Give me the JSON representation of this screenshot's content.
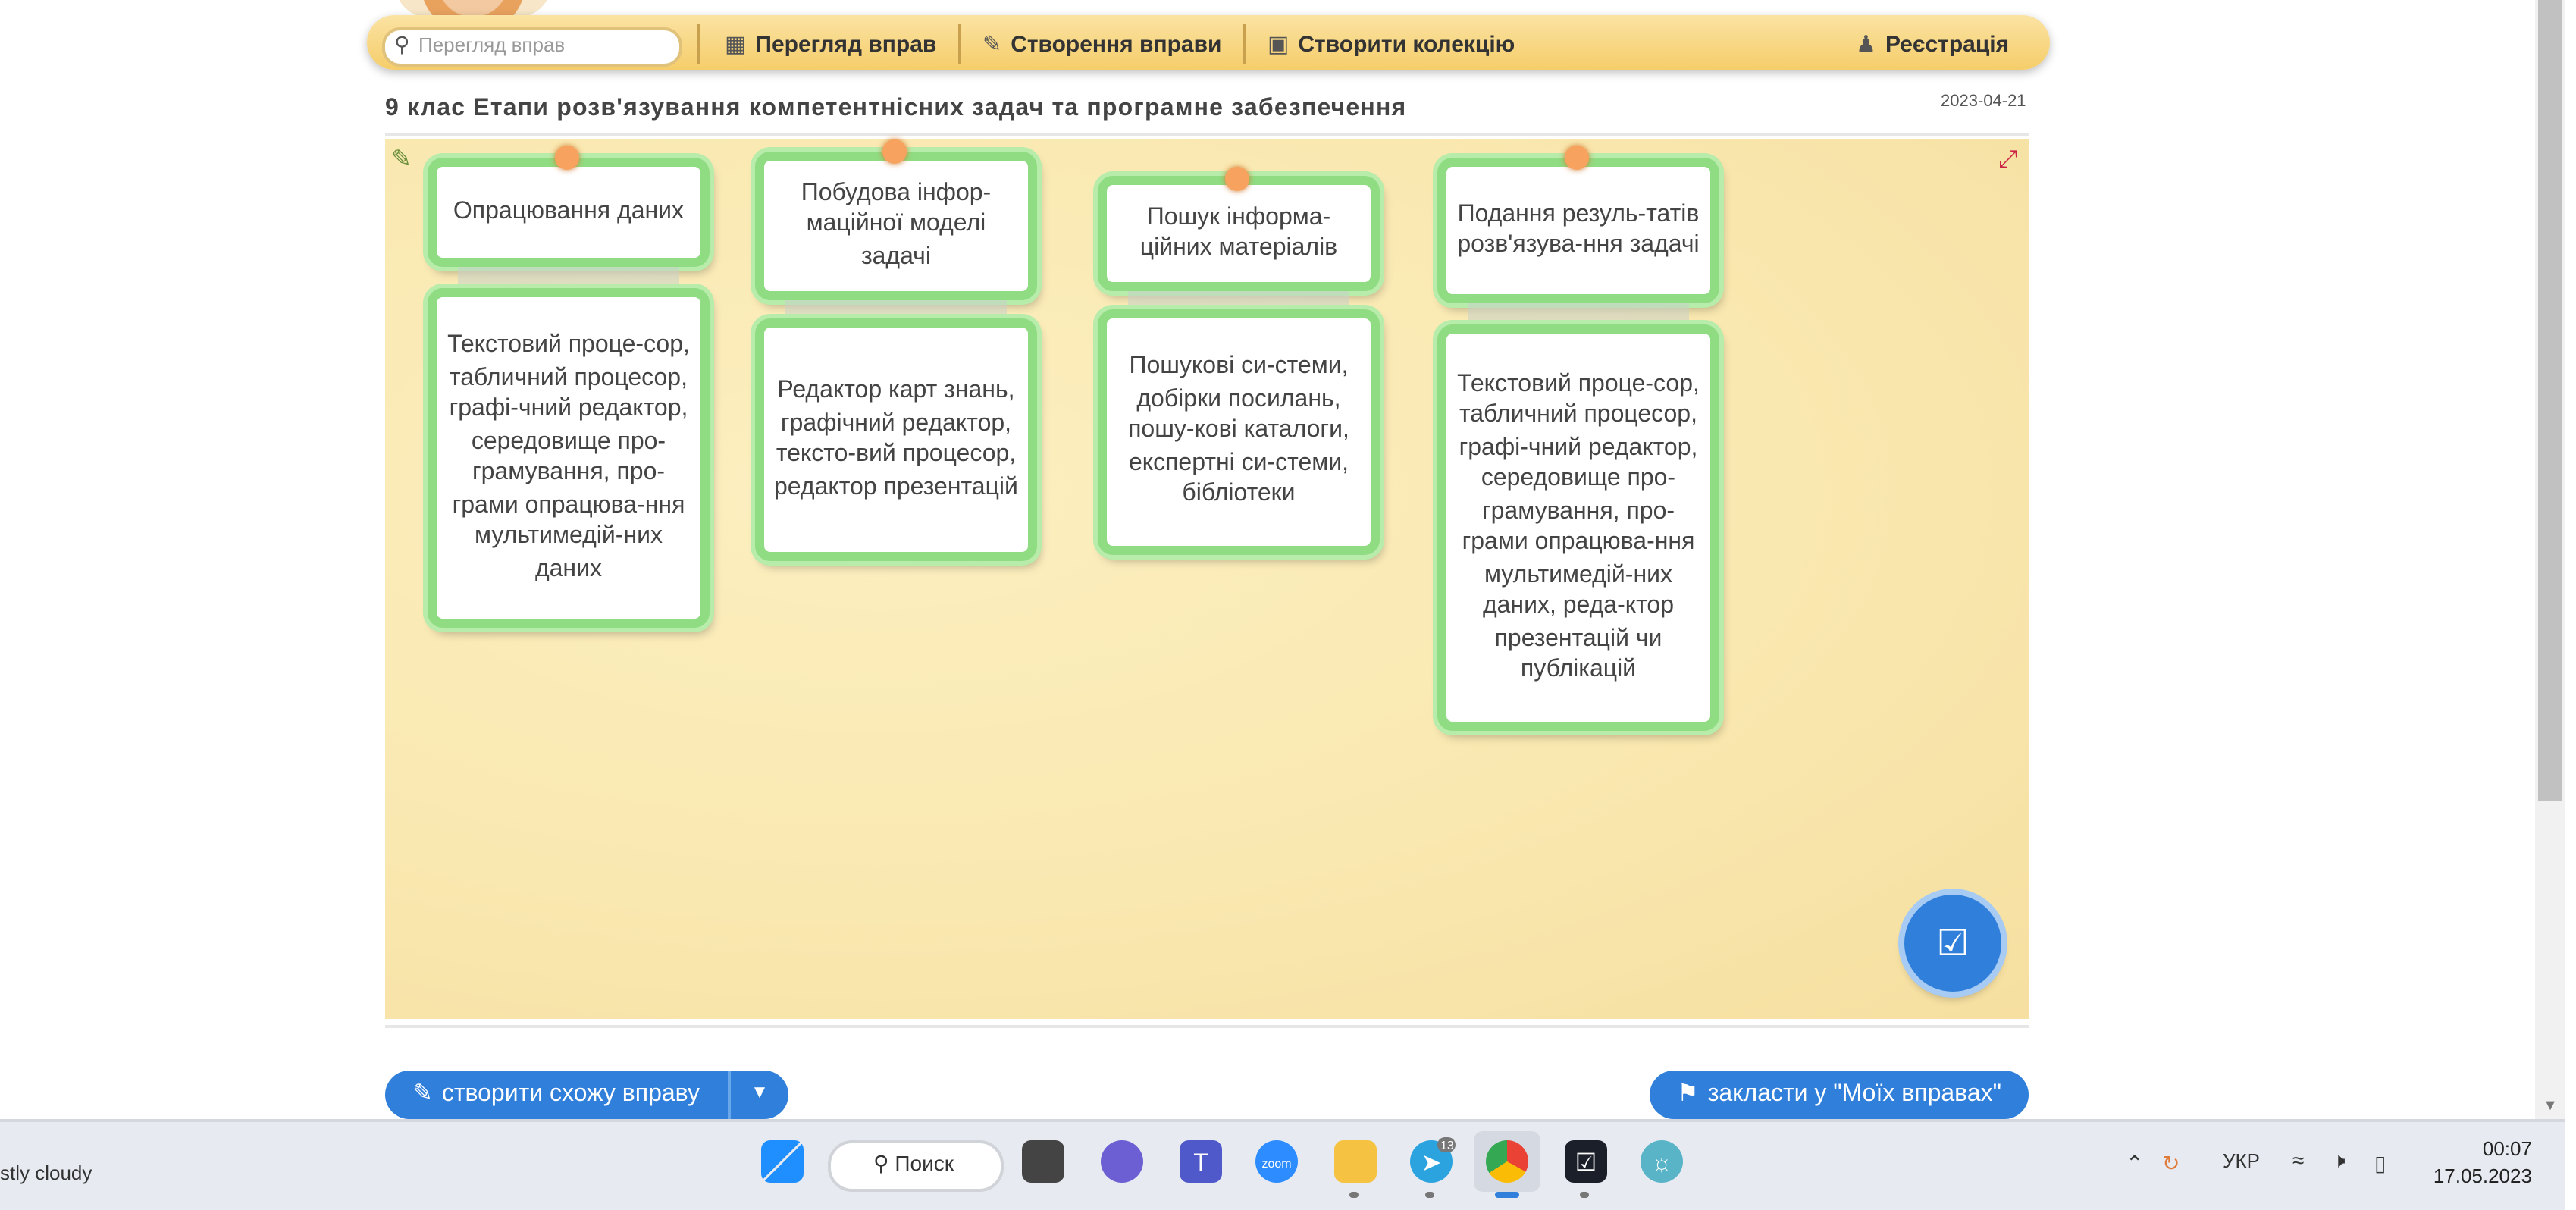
{
  "nav": {
    "search_placeholder": "Перегляд вправ",
    "browse_label": "Перегляд вправ",
    "create_label": "Створення вправи",
    "collection_label": "Створити колекцію",
    "register_label": "Реєстрація"
  },
  "exercise": {
    "title": "9 клас Етапи розв'язування компетентнісних задач та програмне забезпечення",
    "date": "2023-04-21",
    "columns": [
      {
        "header": "Опрацювання даних",
        "body": "Текстовий проце-сор, табличний процесор, графі-чний редактор, середовище про-грамування, про-грами опрацюва-ння мультимедій-них даних"
      },
      {
        "header": "Побудова інфор-маційної моделі задачі",
        "body": "Редактор карт знань, графічний редактор, тексто-вий процесор, редактор презентацій"
      },
      {
        "header": "Пошук інформа-ційних матеріалів",
        "body": "Пошукові си-стеми, добірки посилань, пошу-кові каталоги, експертні си-стеми, бібліотеки"
      },
      {
        "header": "Подання резуль-татів розв'язува-ння задачі",
        "body": "Текстовий проце-сор, табличний процесор, графі-чний редактор, середовище про-грамування, про-грами опрацюва-ння мультимедій-них даних, реда-ктор презентацій чи публікацій"
      }
    ]
  },
  "actions": {
    "create_similar": "створити схожу вправу",
    "bookmark": "закласти у \"Моїх вправах\""
  },
  "taskbar": {
    "weather": "stly cloudy",
    "search_label": "Поиск",
    "telegram_badge": "13",
    "lang": "УКР",
    "time": "00:07",
    "date": "17.05.2023"
  },
  "colors": {
    "accent": "#2f7fdb",
    "card_border": "#8fdc82",
    "pin": "#f7a25e",
    "nav_bg": "#f5cd6a"
  }
}
